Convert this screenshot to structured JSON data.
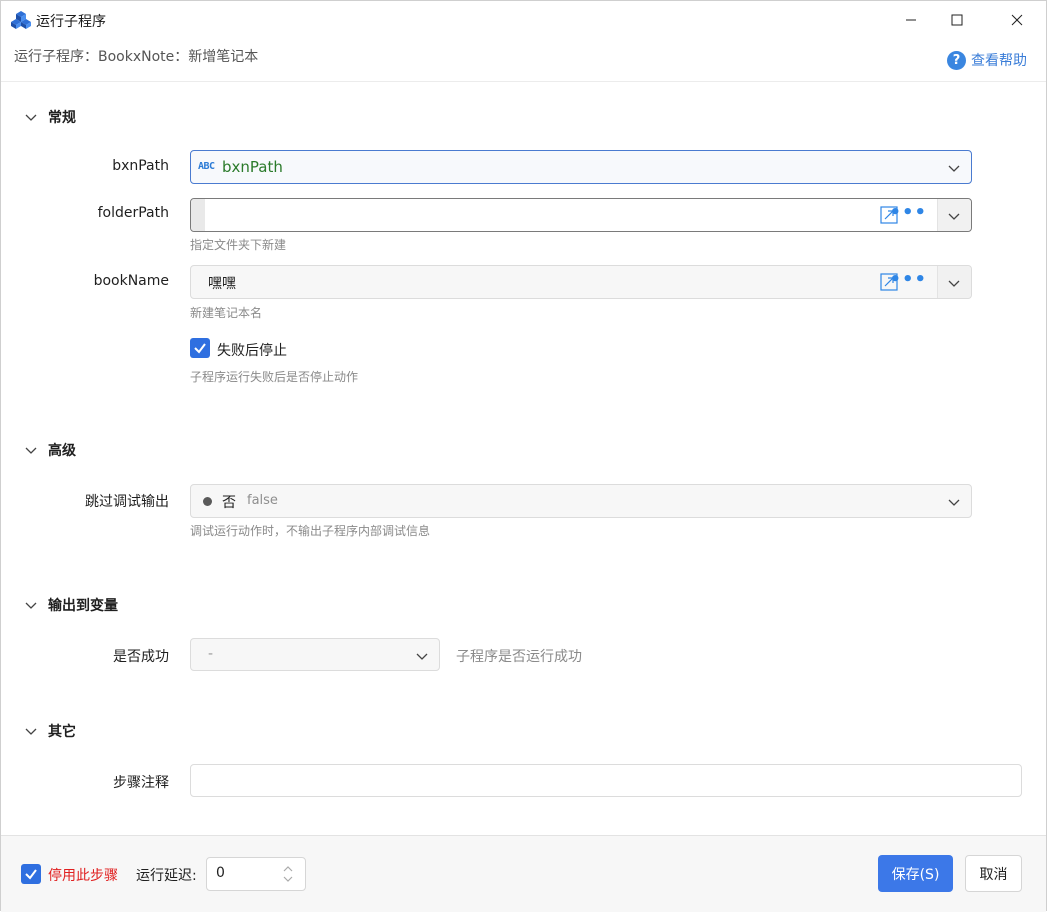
{
  "window": {
    "title": "运行子程序",
    "subtitle": "运行子程序：BookxNote：新增笔记本",
    "help_label": "查看帮助"
  },
  "sections": {
    "general": "常规",
    "advanced": "高级",
    "output": "输出到变量",
    "other": "其它"
  },
  "fields": {
    "bxnPath": {
      "label": "bxnPath",
      "type_badge": "ABC",
      "value": "bxnPath"
    },
    "folderPath": {
      "label": "folderPath",
      "value": "",
      "hint": "指定文件夹下新建"
    },
    "bookName": {
      "label": "bookName",
      "value": "嘿嘿",
      "hint": "新建笔记本名"
    },
    "stop_on_fail": {
      "label": "失败后停止",
      "checked": true,
      "hint": "子程序运行失败后是否停止动作"
    },
    "skip_debug": {
      "label": "跳过调试输出",
      "value": "否",
      "raw": "false",
      "hint": "调试运行动作时，不输出子程序内部调试信息"
    },
    "success": {
      "label": "是否成功",
      "value": "-",
      "hint": "子程序是否运行成功"
    },
    "step_note": {
      "label": "步骤注释",
      "value": ""
    }
  },
  "footer": {
    "disable_label": "停用此步骤",
    "disable_checked": true,
    "delay_label": "运行延迟:",
    "delay_value": "0",
    "save_label": "保存(S)",
    "cancel_label": "取消"
  },
  "colors": {
    "accent": "#3c78e8",
    "danger": "#e02020",
    "link": "#3a7dd8"
  }
}
